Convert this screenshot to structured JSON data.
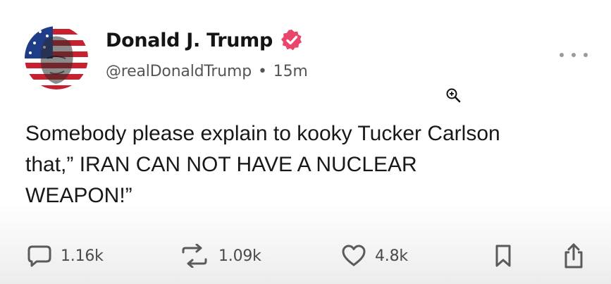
{
  "post": {
    "author": {
      "display_name": "Donald J. Trump",
      "handle": "@realDonaldTrump",
      "verified": true,
      "verified_color": "#e9466b"
    },
    "separator": "•",
    "time_ago": "15m",
    "text": "Somebody please explain to kooky Tucker Carlson\nthat,” IRAN CAN NOT HAVE A NUCLEAR\nWEAPON!”",
    "actions": {
      "replies": "1.16k",
      "reposts": "1.09k",
      "likes": "4.8k"
    }
  },
  "icons": {
    "more": "more-horizontal-icon",
    "reply": "speech-bubble-icon",
    "repost": "repost-arrows-icon",
    "like": "heart-icon",
    "bookmark": "bookmark-icon",
    "share": "share-upload-icon",
    "cursor": "zoom-in-cursor-icon"
  }
}
